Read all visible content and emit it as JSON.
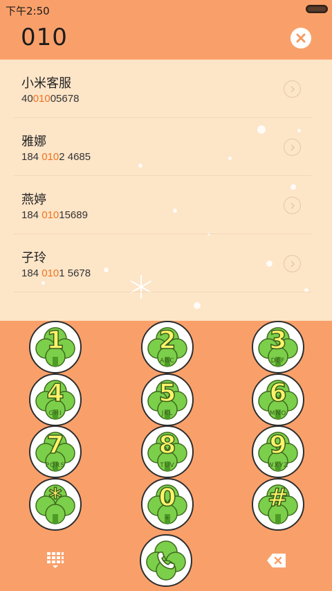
{
  "status_bar": {
    "time": "下午2:50"
  },
  "dialer": {
    "input_value": "010"
  },
  "contacts": [
    {
      "name": "小米客服",
      "number_prefix": "40",
      "number_match": "010",
      "number_suffix": "05678"
    },
    {
      "name": "雅娜",
      "number_prefix": "184 ",
      "number_match": "010",
      "number_suffix": "2 4685"
    },
    {
      "name": "燕婷",
      "number_prefix": "184 ",
      "number_match": "010",
      "number_suffix": "15689"
    },
    {
      "name": "子玲",
      "number_prefix": "184 ",
      "number_match": "010",
      "number_suffix": "1 5678"
    }
  ],
  "keypad": {
    "keys": [
      {
        "digit": "1",
        "letters": ""
      },
      {
        "digit": "2",
        "letters": "ABC"
      },
      {
        "digit": "3",
        "letters": "DEF"
      },
      {
        "digit": "4",
        "letters": "GHI"
      },
      {
        "digit": "5",
        "letters": "JKL"
      },
      {
        "digit": "6",
        "letters": "MNO"
      },
      {
        "digit": "7",
        "letters": "PQRS"
      },
      {
        "digit": "8",
        "letters": "TUV"
      },
      {
        "digit": "9",
        "letters": "WXYZ"
      },
      {
        "digit": "*",
        "letters": ""
      },
      {
        "digit": "0",
        "letters": "+"
      },
      {
        "digit": "#",
        "letters": ""
      }
    ]
  },
  "icons": {
    "clear": "close-icon",
    "detail": "chevron-right-icon",
    "toggle_keypad": "keypad-grid-icon",
    "call": "phone-icon",
    "backspace": "backspace-icon"
  },
  "colors": {
    "header_bg": "#f9a06a",
    "list_bg": "#fde5c8",
    "match_highlight": "#f0731f",
    "key_leaf": "#7ccf4a",
    "key_digit": "#fff36b"
  }
}
